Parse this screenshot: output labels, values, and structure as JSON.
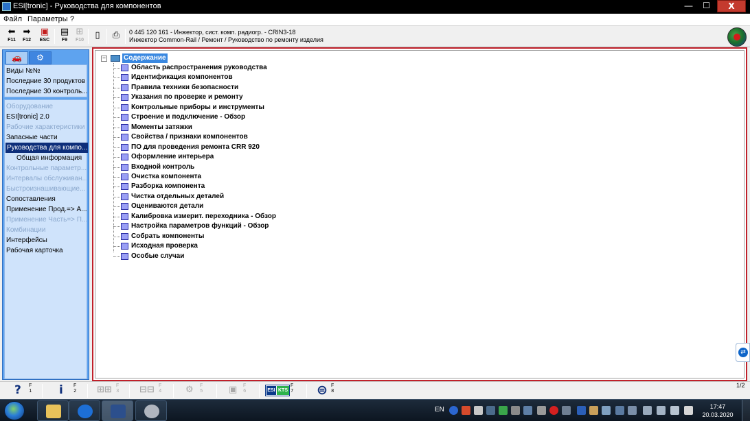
{
  "window": {
    "title": "ESI[tronic] - Руководства для компонентов",
    "minimize_icon": "minimize-icon",
    "maximize_icon": "maximize-icon",
    "close_icon": "close-icon",
    "close_label": "X"
  },
  "menu": {
    "items": [
      "Файл",
      "Параметры",
      "?"
    ]
  },
  "toolbar": {
    "buttons": [
      {
        "icon": "back-arrow-icon",
        "label": "F11"
      },
      {
        "icon": "forward-arrow-icon",
        "label": "F12"
      },
      {
        "icon": "esc-icon",
        "label": "ESC"
      },
      {
        "icon": "list-icon",
        "label": "F9"
      },
      {
        "icon": "tree-icon",
        "label": "F10"
      },
      {
        "icon": "document-icon",
        "label": ""
      },
      {
        "icon": "printer-icon",
        "label": ""
      }
    ],
    "info_line1": "0 445 120 161 - Инжектор, сист. комп. радиогр. - CRIN3-18",
    "info_line2": "Инжектор Common-Rail / Ремонт / Руководство по ремонту изделия",
    "logo": "bosch-globe-logo"
  },
  "sidebar": {
    "tabs": [
      {
        "icon": "car-icon"
      },
      {
        "icon": "engine-icon"
      }
    ],
    "group1": [
      "Виды №№",
      "Последние 30 продуктов",
      "Последние 30 контроль..."
    ],
    "items": [
      {
        "label": "Оборудование",
        "state": "disabled"
      },
      {
        "label": "ESI[tronic] 2.0",
        "state": "normal"
      },
      {
        "label": "Рабочие характеристики",
        "state": "disabled"
      },
      {
        "label": "Запасные части",
        "state": "normal"
      },
      {
        "label": "Руководства для компо...",
        "state": "selected"
      },
      {
        "label": "Общая информация",
        "state": "sub"
      },
      {
        "label": "Контрольные параметр...",
        "state": "disabled"
      },
      {
        "label": "Интервалы обслуживан...",
        "state": "disabled"
      },
      {
        "label": "Быстроизнашивающие...",
        "state": "disabled"
      },
      {
        "label": "Сопоставления",
        "state": "normal"
      },
      {
        "label": "Применение Прод.=> А...",
        "state": "normal"
      },
      {
        "label": "Применение Часть=> П...",
        "state": "disabled"
      },
      {
        "label": "Комбинации",
        "state": "disabled"
      },
      {
        "label": "Интерфейсы",
        "state": "normal"
      },
      {
        "label": "Рабочая карточка",
        "state": "normal"
      }
    ]
  },
  "tree": {
    "toggle": "−",
    "root_label": "Содержание",
    "root_icon": "folder-book-icon",
    "items": [
      "Область распространения руководства",
      "Идентификация компонентов",
      "Правила техники безопасности",
      "Указания по проверке и ремонту",
      "Контрольные приборы и инструменты",
      "Строение и подключение - Обзор",
      "Моменты затяжки",
      "Свойства / признаки компонентов",
      "ПО для проведения ремонта CRR 920",
      "Оформление интерьера",
      "Входной контроль",
      "Очистка компонента",
      "Разборка компонента",
      "Чистка отдельных деталей",
      "Оцениваются детали",
      "Калибровка измерит. переходника - Обзор",
      "Настройка параметров функций - Обзор",
      "Собрать компоненты",
      "Исходная проверка",
      "Особые случаи"
    ]
  },
  "bottombar": {
    "buttons": [
      {
        "icon": "help-icon",
        "glyph": "?",
        "fkey": "F\n1",
        "enabled": true
      },
      {
        "icon": "info-icon",
        "glyph": "i",
        "fkey": "F\n2",
        "enabled": true
      },
      {
        "icon": "circuit-icon",
        "glyph": "",
        "fkey": "F\n3",
        "enabled": false
      },
      {
        "icon": "wiring-icon",
        "glyph": "",
        "fkey": "F\n4",
        "enabled": false
      },
      {
        "icon": "component-icon",
        "glyph": "",
        "fkey": "F\n5",
        "enabled": false
      },
      {
        "icon": "module-icon",
        "glyph": "",
        "fkey": "F\n6",
        "enabled": false
      },
      {
        "icon": "esi-kts-icon",
        "glyph": "",
        "fkey": "F\n7",
        "enabled": true
      },
      {
        "icon": "bosch-icon",
        "glyph": "",
        "fkey": "F\n8",
        "enabled": true
      }
    ],
    "esi_label": "ESI",
    "kts_label": "KTS",
    "page": "1/2"
  },
  "taskbar": {
    "apps": [
      {
        "icon": "explorer-icon",
        "color": "#e8c25a"
      },
      {
        "icon": "teamviewer-icon",
        "color": "#1d6fd6"
      },
      {
        "icon": "esi-tronic-car-icon",
        "color": "#2c4f8c"
      },
      {
        "icon": "cd-disc-icon",
        "color": "#b0b6bf"
      }
    ],
    "lang": "EN",
    "time": "17:47",
    "date": "20.03.2020",
    "tray_icons": [
      "help-tray-icon",
      "paint-tray-icon",
      "update-tray-icon",
      "gpu-tray-icon",
      "usb-tray-icon",
      "app-tray-icon",
      "monitor-tray-icon",
      "record-tray-icon",
      "keyboard-tray-icon",
      "bluetooth-tray-icon",
      "folder-tray-icon",
      "network-tray-icon",
      "speaker-tray-icon",
      "flag-tray-icon"
    ]
  },
  "colors": {
    "sidebar_bg": "#5ea3ef",
    "selected": "#0d2e7a",
    "content_border": "#c0202a",
    "tree_root_highlight": "#3a88e0"
  }
}
